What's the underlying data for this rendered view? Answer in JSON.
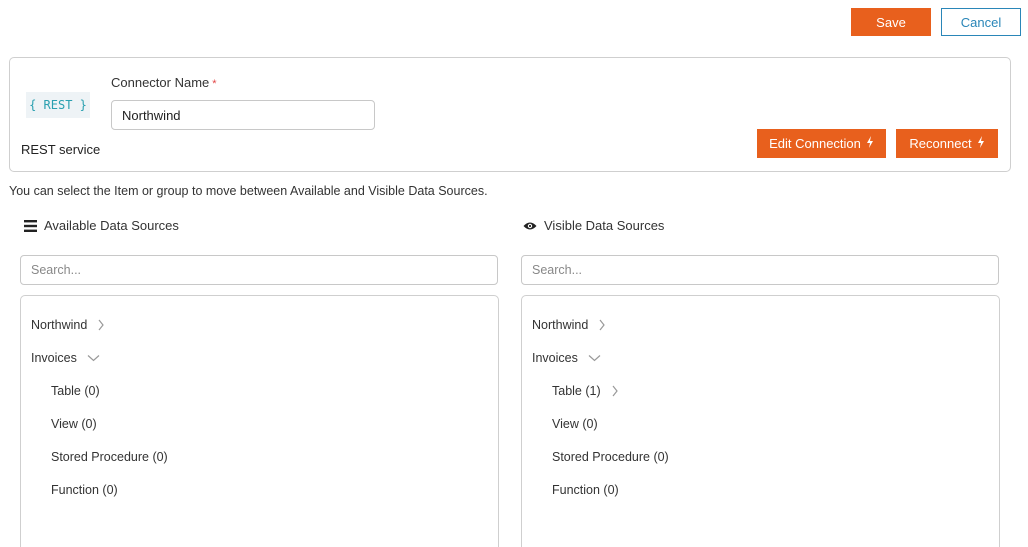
{
  "toolbar": {
    "save_label": "Save",
    "cancel_label": "Cancel"
  },
  "connector": {
    "badge_text": "{ REST }",
    "type_label": "REST service",
    "name_label": "Connector Name",
    "required_mark": "*",
    "name_value": "Northwind",
    "edit_connection_label": "Edit Connection",
    "reconnect_label": "Reconnect"
  },
  "hint": "You can select the Item or group to move between Available and Visible Data Sources.",
  "available": {
    "title": "Available Data Sources",
    "icon": "list-icon",
    "search_placeholder": "Search...",
    "items": [
      {
        "label": "Northwind",
        "chevron": "right"
      },
      {
        "label": "Invoices",
        "chevron": "down"
      },
      {
        "label": "Table (0)"
      },
      {
        "label": "View (0)"
      },
      {
        "label": "Stored Procedure (0)"
      },
      {
        "label": "Function (0)"
      }
    ]
  },
  "visible": {
    "title": "Visible Data Sources",
    "icon": "eye-icon",
    "search_placeholder": "Search...",
    "items": [
      {
        "label": "Northwind",
        "chevron": "right"
      },
      {
        "label": "Invoices",
        "chevron": "down"
      },
      {
        "label": "Table (1)",
        "chevron": "right"
      },
      {
        "label": "View (0)"
      },
      {
        "label": "Stored Procedure (0)"
      },
      {
        "label": "Function (0)"
      }
    ]
  },
  "colors": {
    "accent": "#e8601d",
    "link": "#2a86b8",
    "border": "#cfcfcf"
  }
}
